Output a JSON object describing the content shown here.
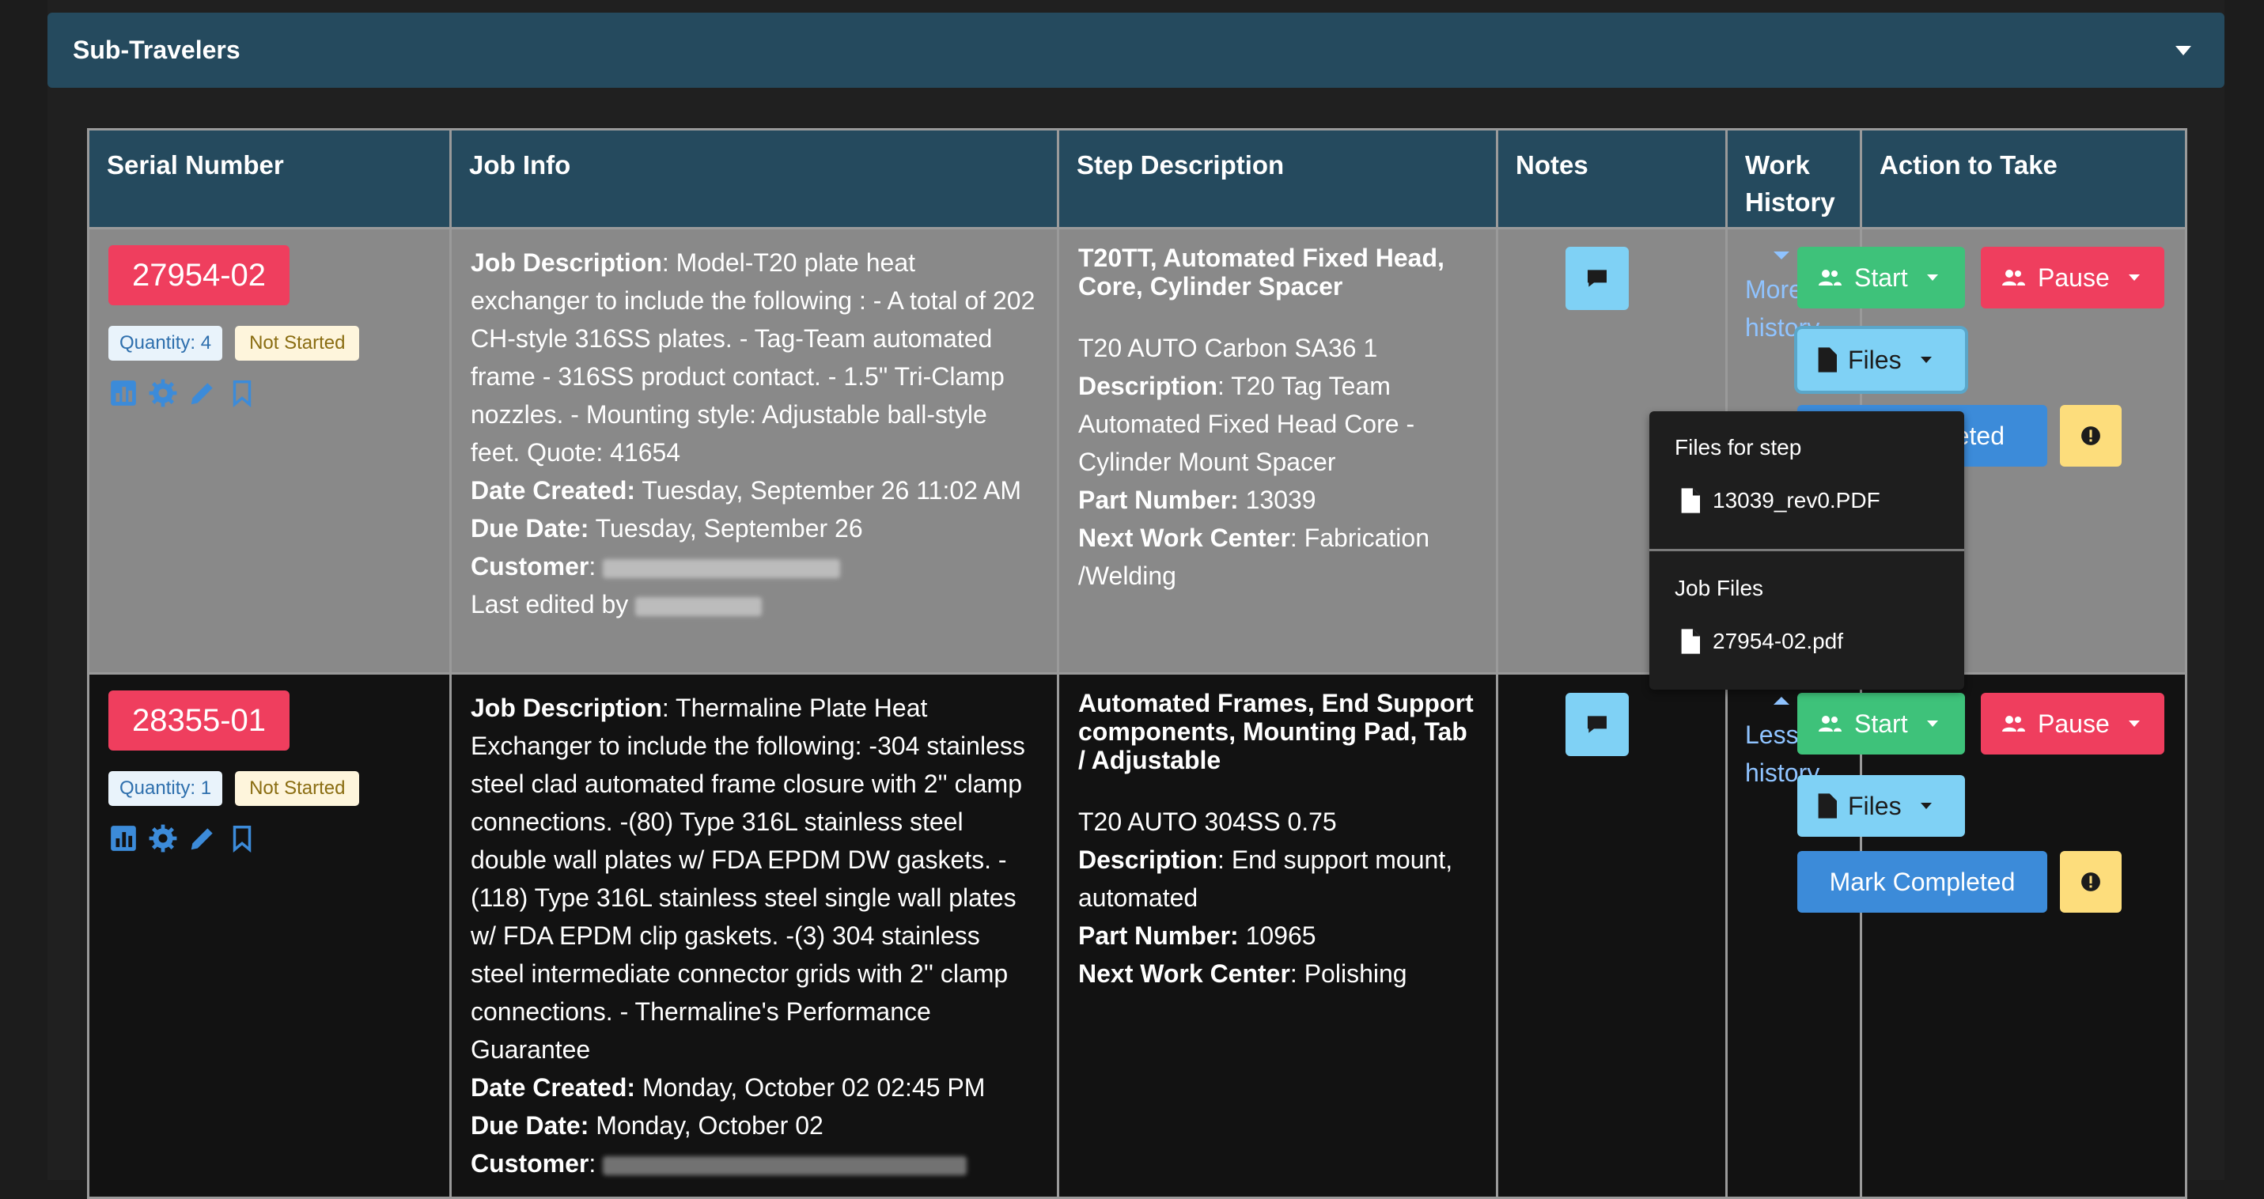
{
  "panel": {
    "title": "Sub-Travelers"
  },
  "table": {
    "headers": [
      "Serial Number",
      "Job Info",
      "Step Description",
      "Notes",
      "Work History",
      "Action to Take"
    ]
  },
  "rows": [
    {
      "serial": "27954-02",
      "quantity": "Quantity: 4",
      "status": "Not Started",
      "job_description_label": "Job Description",
      "job_description": ": Model-T20 plate heat exchanger to include the following : - A total of 202 CH-style 316SS plates. - Tag-Team automated frame - 316SS product contact. - 1.5\" Tri-Clamp nozzles. - Mounting style: Adjustable ball-style feet. Quote: 41654",
      "date_created_label": "Date Created:",
      "date_created": " Tuesday, September 26 11:02 AM",
      "due_date_label": "Due Date:",
      "due_date": " Tuesday, September 26",
      "customer_label": "Customer",
      "last_edited_label": "Last edited by",
      "step_title": "T20TT, Automated Fixed Head, Core, Cylinder Spacer",
      "step_material": "T20 AUTO Carbon SA36 1",
      "step_description_label": "Description",
      "step_description": ": T20 Tag Team Automated Fixed Head Core - Cylinder Mount Spacer",
      "part_number_label": "Part Number:",
      "part_number": " 13039",
      "next_wc_label": "Next Work Center",
      "next_wc": ": Fabrication /Welding",
      "history_link": "More history",
      "history_line1": "More",
      "history_line2": "history"
    },
    {
      "serial": "28355-01",
      "quantity": "Quantity: 1",
      "status": "Not Started",
      "job_description_label": "Job Description",
      "job_description": ": Thermaline Plate Heat Exchanger to include the following: -304 stainless steel clad automated frame closure with 2'' clamp connections. -(80) Type 316L stainless steel double wall plates w/ FDA EPDM DW gaskets. -(118) Type 316L stainless steel single wall plates w/ FDA EPDM clip gaskets. -(3) 304 stainless steel intermediate connector grids with 2'' clamp connections. - Thermaline's Performance Guarantee",
      "date_created_label": "Date Created:",
      "date_created": " Monday, October 02 02:45 PM",
      "due_date_label": "Due Date:",
      "due_date": " Monday, October 02",
      "customer_label": "Customer",
      "step_title": "Automated Frames, End Support components, Mounting Pad, Tab / Adjustable",
      "step_material": "T20 AUTO 304SS 0.75",
      "step_description_label": "Description",
      "step_description": ": End support mount, automated",
      "part_number_label": "Part Number:",
      "part_number": " 10965",
      "next_wc_label": "Next Work Center",
      "next_wc": ": Polishing",
      "history_line1": "Less",
      "history_line2": "history"
    }
  ],
  "actions": {
    "start": "Start",
    "pause": "Pause",
    "files": "Files",
    "mark_completed": "Mark Completed"
  },
  "files_dropdown": {
    "step_header": "Files for step",
    "step_file": "13039_rev0.PDF",
    "job_header": "Job Files",
    "job_file": "27954-02.pdf"
  },
  "colors": {
    "header_bg": "#254a5e",
    "danger": "#ef3e5e",
    "success": "#3ec27a",
    "info": "#7fd1f5",
    "primary": "#3c8bd9",
    "warning": "#fddd7c"
  }
}
